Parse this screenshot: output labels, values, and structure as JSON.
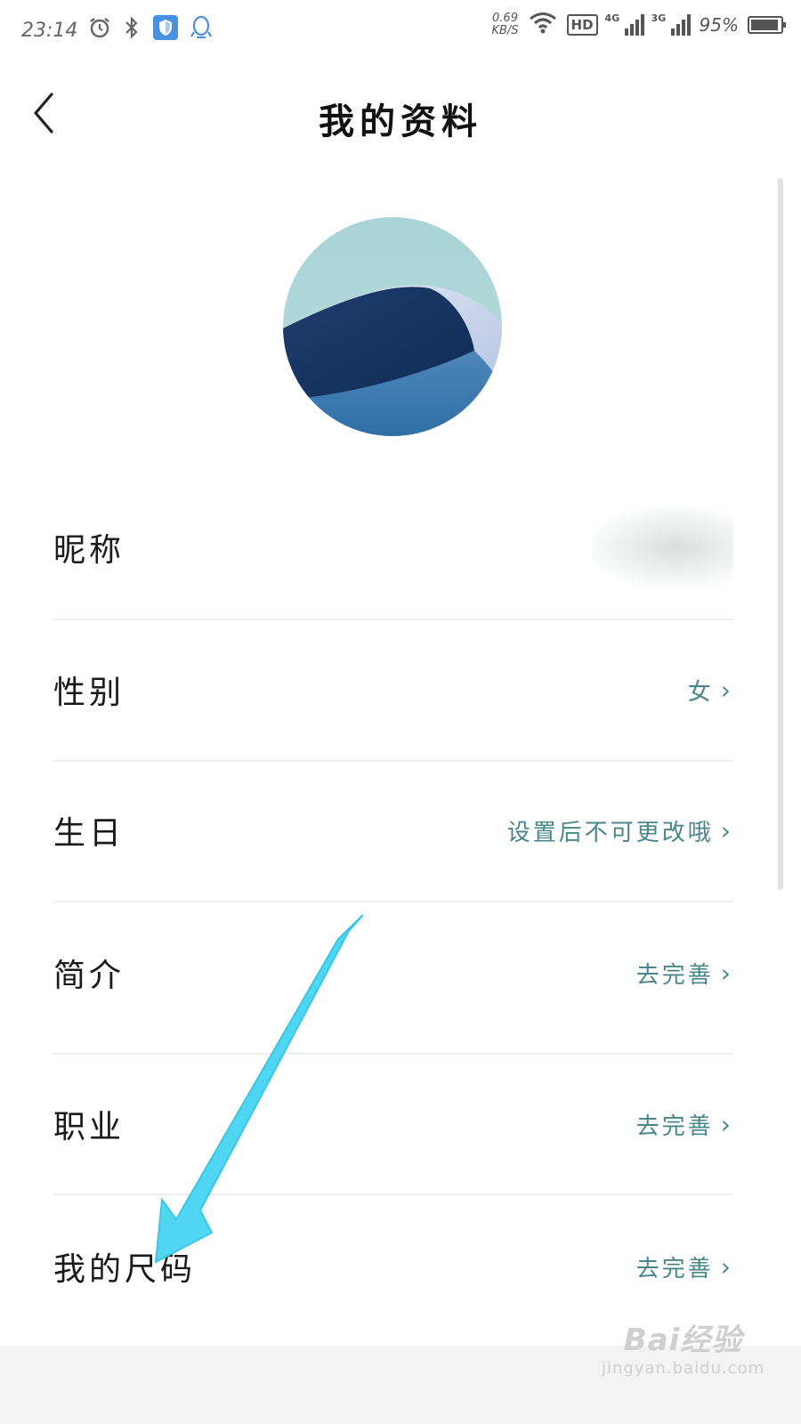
{
  "status_bar": {
    "time": "23:14",
    "speed_value": "0.69",
    "speed_unit": "KB/S",
    "hd_label": "HD",
    "net1": "4G",
    "net2": "3G",
    "battery_percent": "95%",
    "battery_level": 0.95,
    "icons": [
      "alarm-icon",
      "bluetooth-icon",
      "shield-icon",
      "qq-icon",
      "wifi-icon",
      "signal-icon",
      "battery-icon"
    ]
  },
  "header": {
    "title": "我的资料",
    "back_icon": "chevron-left-icon"
  },
  "profile": {
    "rows": [
      {
        "label": "昵称",
        "value": ""
      },
      {
        "label": "性别",
        "value": "女"
      },
      {
        "label": "生日",
        "value": "设置后不可更改哦"
      },
      {
        "label": "简介",
        "value": "去完善"
      },
      {
        "label": "职业",
        "value": "去完善"
      },
      {
        "label": "我的尺码",
        "value": "去完善"
      }
    ],
    "chevron": "›"
  },
  "watermark": {
    "main": "Bai经验",
    "sub": "jingyan.baidu.com"
  },
  "colors": {
    "accent_value": "#4a8688",
    "annotation_arrow": "#4fd6f2"
  }
}
